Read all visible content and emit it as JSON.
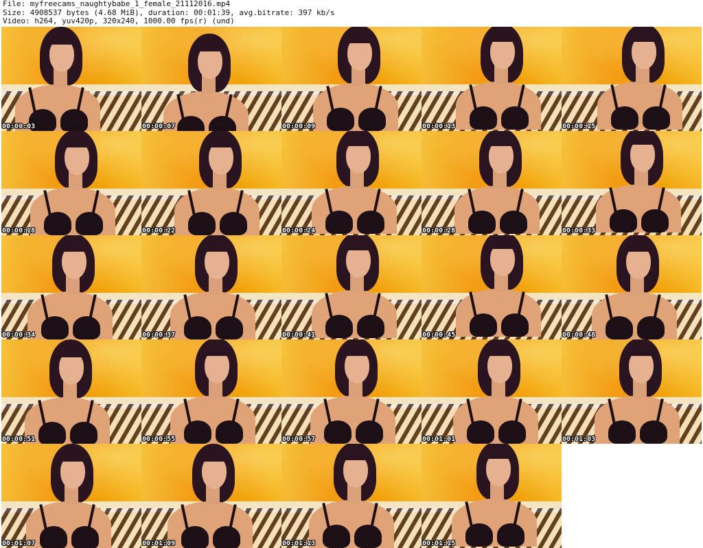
{
  "header": {
    "line1": "File: myfreecams_naughtybabe_1_female_21112016.mp4",
    "line2": "Size: 4908537 bytes (4.68 MiB), duration: 00:01:39, avg.bitrate: 397 kb/s",
    "line3": "Video: h264, yuv420p, 320x240, 1000.00 fps(r) (und)"
  },
  "thumbnails": [
    {
      "timestamp": "00:00:03"
    },
    {
      "timestamp": "00:00:07"
    },
    {
      "timestamp": "00:00:09"
    },
    {
      "timestamp": "00:00:13"
    },
    {
      "timestamp": "00:00:15"
    },
    {
      "timestamp": "00:00:18"
    },
    {
      "timestamp": "00:00:22"
    },
    {
      "timestamp": "00:00:24"
    },
    {
      "timestamp": "00:00:28"
    },
    {
      "timestamp": "00:00:33"
    },
    {
      "timestamp": "00:00:34"
    },
    {
      "timestamp": "00:00:37"
    },
    {
      "timestamp": "00:00:41"
    },
    {
      "timestamp": "00:00:45"
    },
    {
      "timestamp": "00:00:48"
    },
    {
      "timestamp": "00:00:51"
    },
    {
      "timestamp": "00:00:55"
    },
    {
      "timestamp": "00:00:57"
    },
    {
      "timestamp": "00:01:01"
    },
    {
      "timestamp": "00:01:03"
    },
    {
      "timestamp": "00:01:07"
    },
    {
      "timestamp": "00:01:09"
    },
    {
      "timestamp": "00:01:13"
    },
    {
      "timestamp": "00:01:15"
    }
  ],
  "colors": {
    "background": "#ffffff",
    "wall": "#f39b12",
    "hair": "#2a1420",
    "timestamp_text": "#ffffff"
  }
}
